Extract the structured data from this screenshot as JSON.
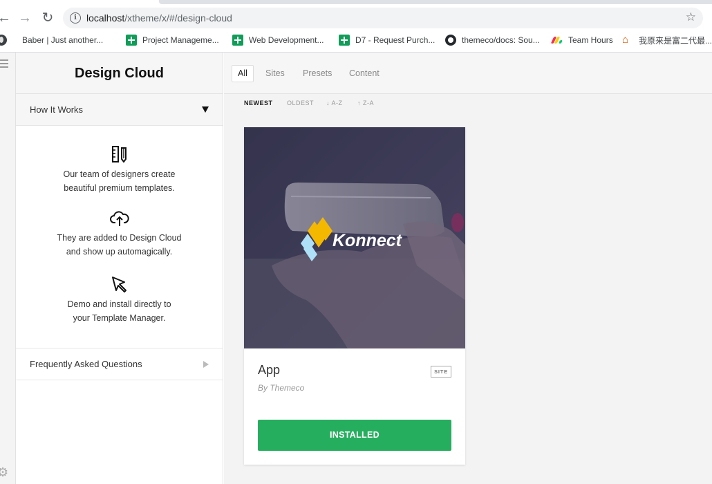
{
  "browser": {
    "url_host": "localhost",
    "url_path": "/xtheme/x/#/design-cloud",
    "bookmarks": [
      {
        "label": "Baber | Just another...",
        "icon": "globe-icon"
      },
      {
        "label": "Project Manageme...",
        "icon": "sheets-icon"
      },
      {
        "label": "Web Development...",
        "icon": "sheets-icon"
      },
      {
        "label": "D7 - Request Purch...",
        "icon": "sheets-icon"
      },
      {
        "label": "themeco/docs: Sou...",
        "icon": "github-icon"
      },
      {
        "label": "Team Hours",
        "icon": "monday-icon"
      },
      {
        "label": "我原来是富二代最...",
        "icon": "house-icon"
      }
    ]
  },
  "sidebar": {
    "title": "Design Cloud",
    "how_it_works": {
      "label": "How It Works",
      "steps": [
        {
          "icon": "ruler-pencil-icon",
          "line1": "Our team of designers create",
          "line2": "beautiful premium templates."
        },
        {
          "icon": "cloud-upload-icon",
          "line1": "They are added to Design Cloud",
          "line2": "and show up automagically."
        },
        {
          "icon": "cursor-arrow-icon",
          "line1": "Demo and install directly to",
          "line2": "your Template Manager."
        }
      ]
    },
    "faq_label": "Frequently Asked Questions"
  },
  "main": {
    "tabs": [
      "All",
      "Sites",
      "Presets",
      "Content"
    ],
    "active_tab": "All",
    "sort": [
      "NEWEST",
      "OLDEST",
      "↓ A-Z",
      "↑ Z-A"
    ],
    "card": {
      "logo_text": "Konnect",
      "title": "App",
      "badge": "SITE",
      "author": "By Themeco",
      "button": "INSTALLED"
    }
  },
  "colors": {
    "install_green": "#26ae5f",
    "thumb_overlay": "#2b2a48"
  }
}
